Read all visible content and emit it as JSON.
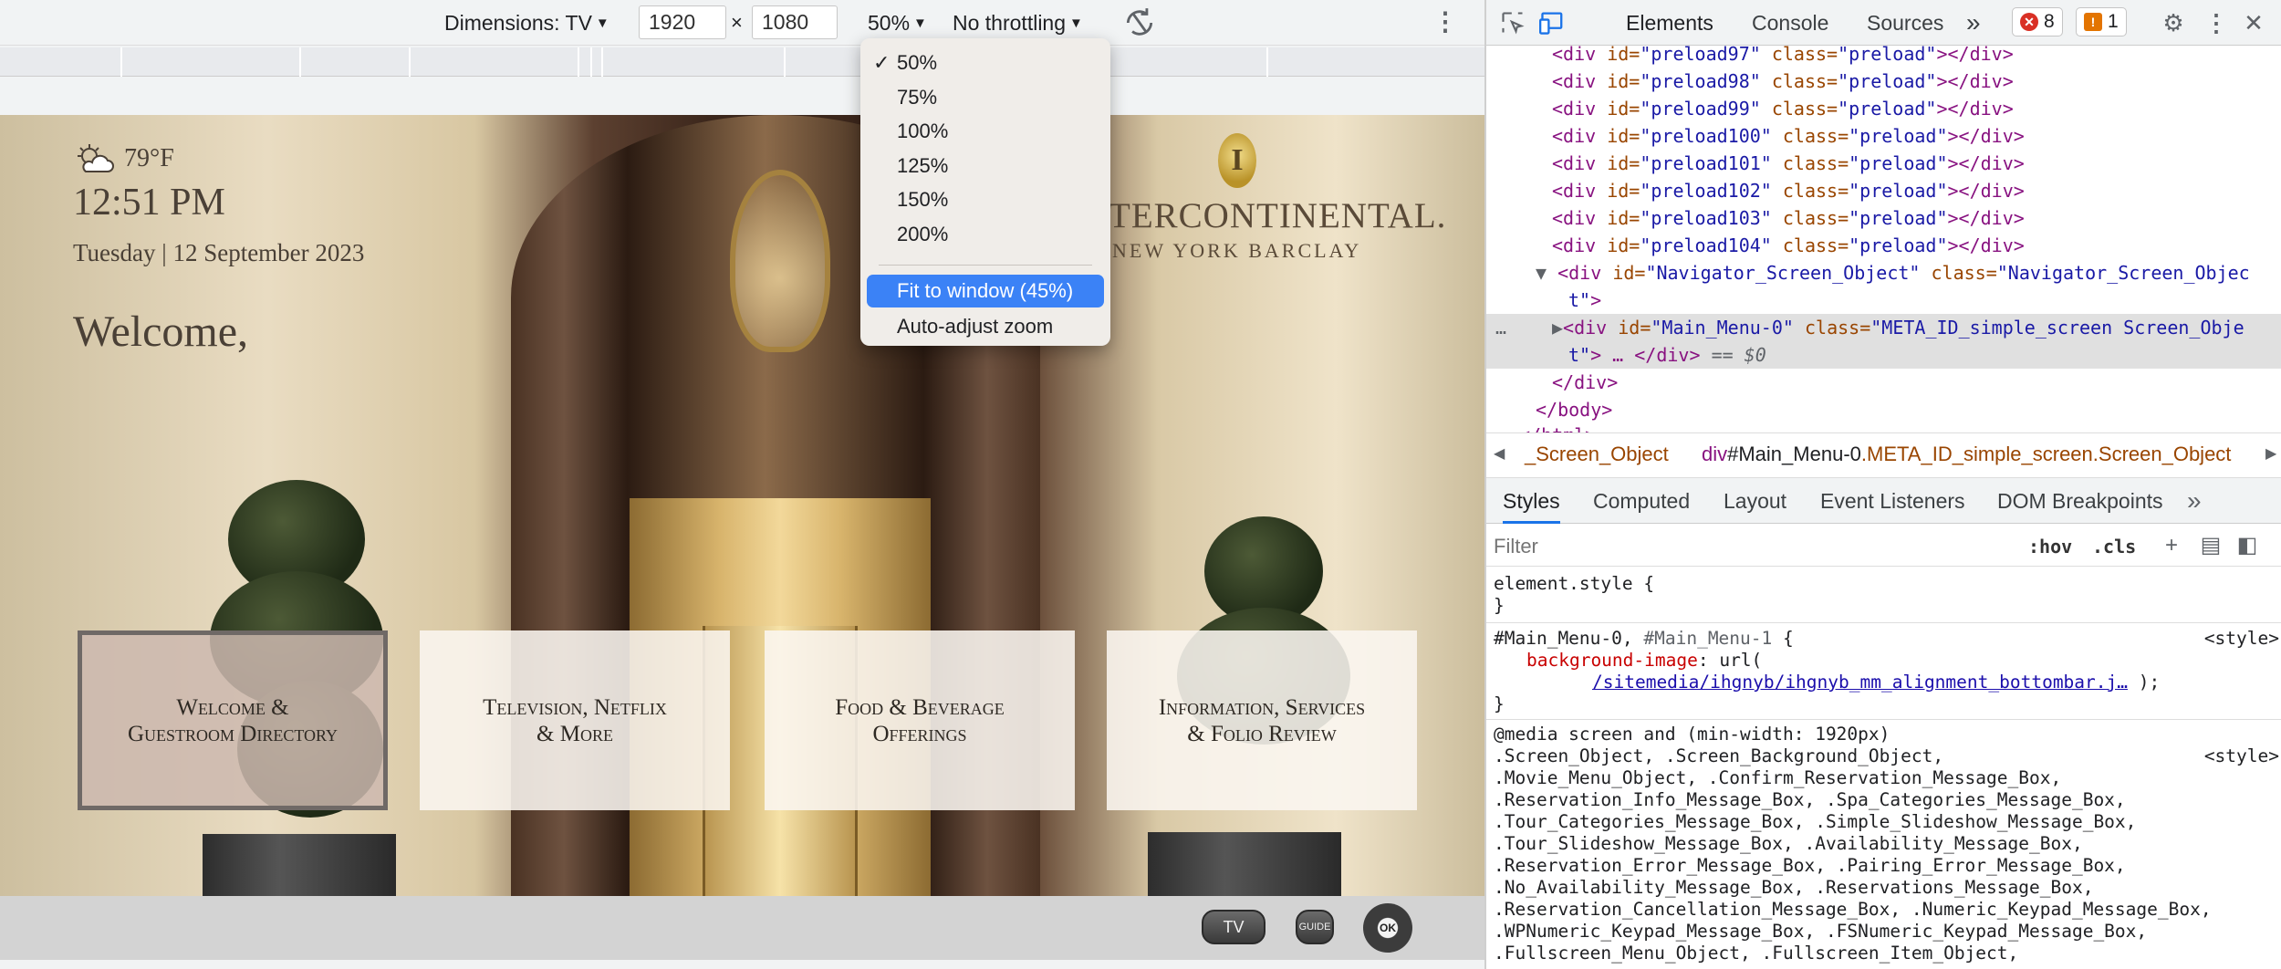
{
  "device_toolbar": {
    "dimensions_label": "Dimensions: TV",
    "width_value": "1920",
    "times": "×",
    "height_value": "1080",
    "zoom_label": "50%",
    "throttling_label": "No throttling",
    "rotate_icon": "rotate-icon",
    "more_icon": "more-vert-icon"
  },
  "zoom_menu": {
    "check": "✓",
    "options": [
      "50%",
      "75%",
      "100%",
      "125%",
      "150%",
      "200%"
    ],
    "selected": "50%",
    "fit_label": "Fit to window (45%)",
    "auto_label": "Auto-adjust zoom"
  },
  "page": {
    "temperature": "79°F",
    "time": "12:51 PM",
    "day": "Tuesday",
    "date_sep": "|",
    "date": "12 September 2023",
    "welcome": "Welcome,",
    "logo_letter": "I",
    "logo_name": "TERCONTINENTAL.",
    "logo_sub": "NEW YORK BARCLAY",
    "menu": [
      {
        "line1": "Welcome &",
        "line2": "Guestroom Directory"
      },
      {
        "line1": "Television, Netflix",
        "line2": "& More"
      },
      {
        "line1": "Food & Beverage",
        "line2": "Offerings"
      },
      {
        "line1": "Information, Services",
        "line2": "& Folio Review"
      }
    ],
    "remote": {
      "tv": "TV",
      "guide": "GUIDE",
      "ok": "OK"
    }
  },
  "devtools": {
    "tabs": [
      "Elements",
      "Console",
      "Sources"
    ],
    "more_tabs": "»",
    "error_count": "8",
    "warning_count": "1",
    "dom_lines": {
      "preloads": [
        {
          "id": "\"preload97\"",
          "cls": "\"preload\""
        },
        {
          "id": "\"preload98\"",
          "cls": "\"preload\""
        },
        {
          "id": "\"preload99\"",
          "cls": "\"preload\""
        },
        {
          "id": "\"preload100\"",
          "cls": "\"preload\""
        },
        {
          "id": "\"preload101\"",
          "cls": "\"preload\""
        },
        {
          "id": "\"preload102\"",
          "cls": "\"preload\""
        },
        {
          "id": "\"preload103\"",
          "cls": "\"preload\""
        },
        {
          "id": "\"preload104\"",
          "cls": "\"preload\""
        }
      ],
      "nav_open": "<div",
      "nav_id_attr": "id=",
      "nav_id": "\"Navigator_Screen_Object\"",
      "nav_class_attr": "class=",
      "nav_class": "\"Navigator_Screen_Objec",
      "nav_class_cont": "t\"",
      "nav_close": ">",
      "main_open": "<div",
      "main_id_attr": "id=",
      "main_id": "\"Main_Menu-0\"",
      "main_class_attr": "class=",
      "main_class": "\"META_ID_simple_screen Screen_Obje",
      "main_class_cont": "t\"",
      "main_after": "> … </div>",
      "main_eq": "== $0",
      "close_div": "</div>",
      "close_body": "</body>",
      "close_html": "</html>"
    },
    "breadcrumb_left": "_Screen_Object",
    "breadcrumb_tag": "div",
    "breadcrumb_id": "#Main_Menu-0",
    "breadcrumb_classes": ".META_ID_simple_screen.Screen_Object",
    "style_tabs": [
      "Styles",
      "Computed",
      "Layout",
      "Event Listeners",
      "DOM Breakpoints"
    ],
    "filter_placeholder": "Filter",
    "hov": ":hov",
    "cls": ".cls",
    "rules": {
      "element_style": "element.style {",
      "close_brace": "}",
      "main_selector": "#Main_Menu-0,",
      "main_selector2": "#Main_Menu-1",
      "open_brace": "{",
      "origin": "<style>",
      "prop_bg": "background-image",
      "prop_bg_val": "url(",
      "bg_link": "/sitemedia/ihgnyb/ihgnyb_mm_alignment_bottombar.j…",
      "bg_end": ");",
      "media": "@media screen and (min-width: 1920px)",
      "selectors": [
        ".Screen_Object, .Screen_Background_Object,",
        ".Movie_Menu_Object, .Confirm_Reservation_Message_Box,",
        ".Reservation_Info_Message_Box, .Spa_Categories_Message_Box,",
        ".Tour_Categories_Message_Box, .Simple_Slideshow_Message_Box,",
        ".Tour_Slideshow_Message_Box, .Availability_Message_Box,",
        ".Reservation_Error_Message_Box, .Pairing_Error_Message_Box,",
        ".No_Availability_Message_Box, .Reservations_Message_Box,",
        ".Reservation_Cancellation_Message_Box, .Numeric_Keypad_Message_Box,",
        ".WPNumeric_Keypad_Message_Box, .FSNumeric_Keypad_Message_Box,",
        ".Fullscreen_Menu_Object, .Fullscreen_Item_Object,"
      ]
    }
  },
  "colors": {
    "accent": "#1a73e8",
    "highlight": "#3b82f6",
    "error": "#d93025",
    "warning": "#e37400"
  }
}
